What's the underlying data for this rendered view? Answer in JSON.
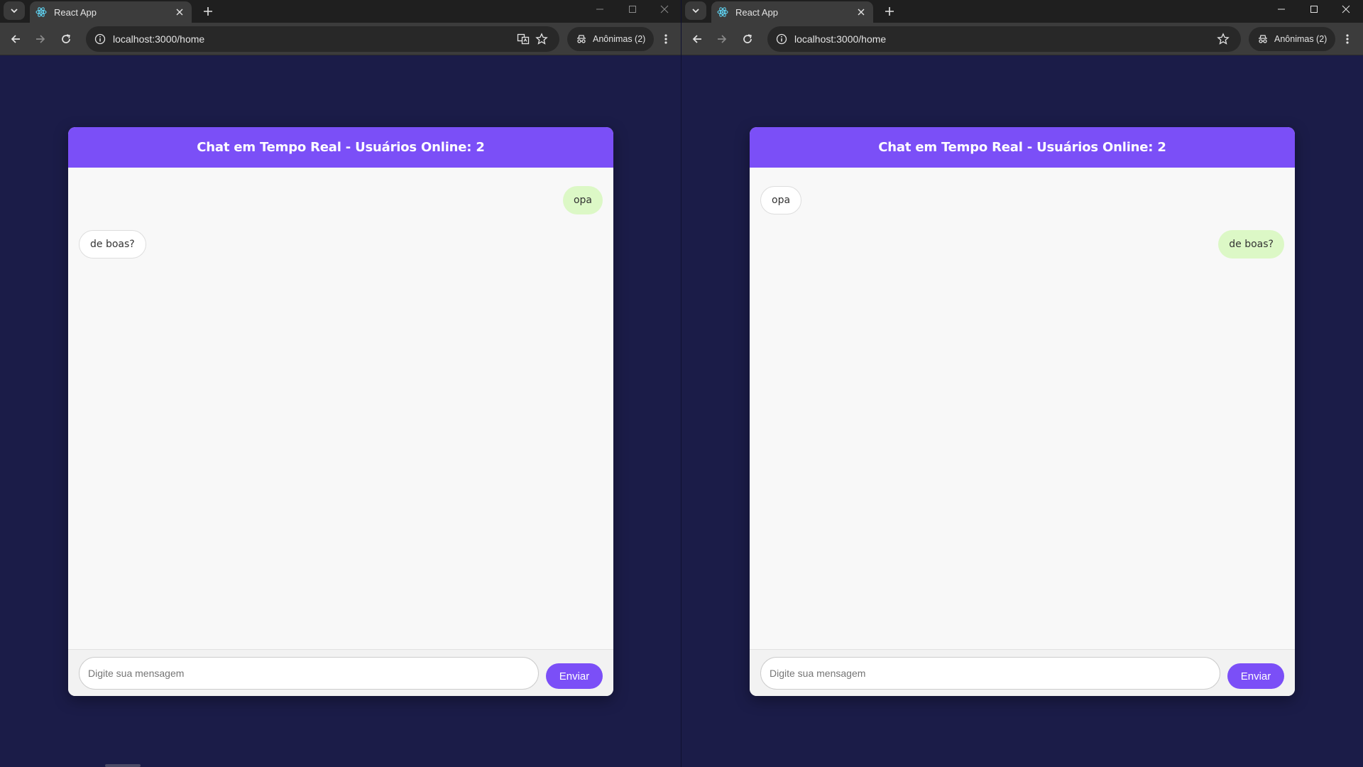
{
  "colors": {
    "page_bg": "#1b1c48",
    "header": "#7b4ff7",
    "own_bubble": "#dcf8c6",
    "other_bubble": "#ffffff",
    "send_button": "#7b4ff7"
  },
  "left": {
    "tab_title": "React App",
    "url": "localhost:3000/home",
    "profile_label": "Anônimas (2)",
    "chat": {
      "title": "Chat em Tempo Real - Usuários Online: 2",
      "messages": [
        {
          "text": "opa",
          "side": "mine"
        },
        {
          "text": "de boas?",
          "side": "theirs"
        }
      ],
      "input_placeholder": "Digite sua mensagem",
      "send_label": "Enviar"
    }
  },
  "right": {
    "tab_title": "React App",
    "url": "localhost:3000/home",
    "profile_label": "Anônimas (2)",
    "chat": {
      "title": "Chat em Tempo Real - Usuários Online: 2",
      "messages": [
        {
          "text": "opa",
          "side": "theirs"
        },
        {
          "text": "de boas?",
          "side": "mine"
        }
      ],
      "input_placeholder": "Digite sua mensagem",
      "send_label": "Enviar"
    }
  }
}
